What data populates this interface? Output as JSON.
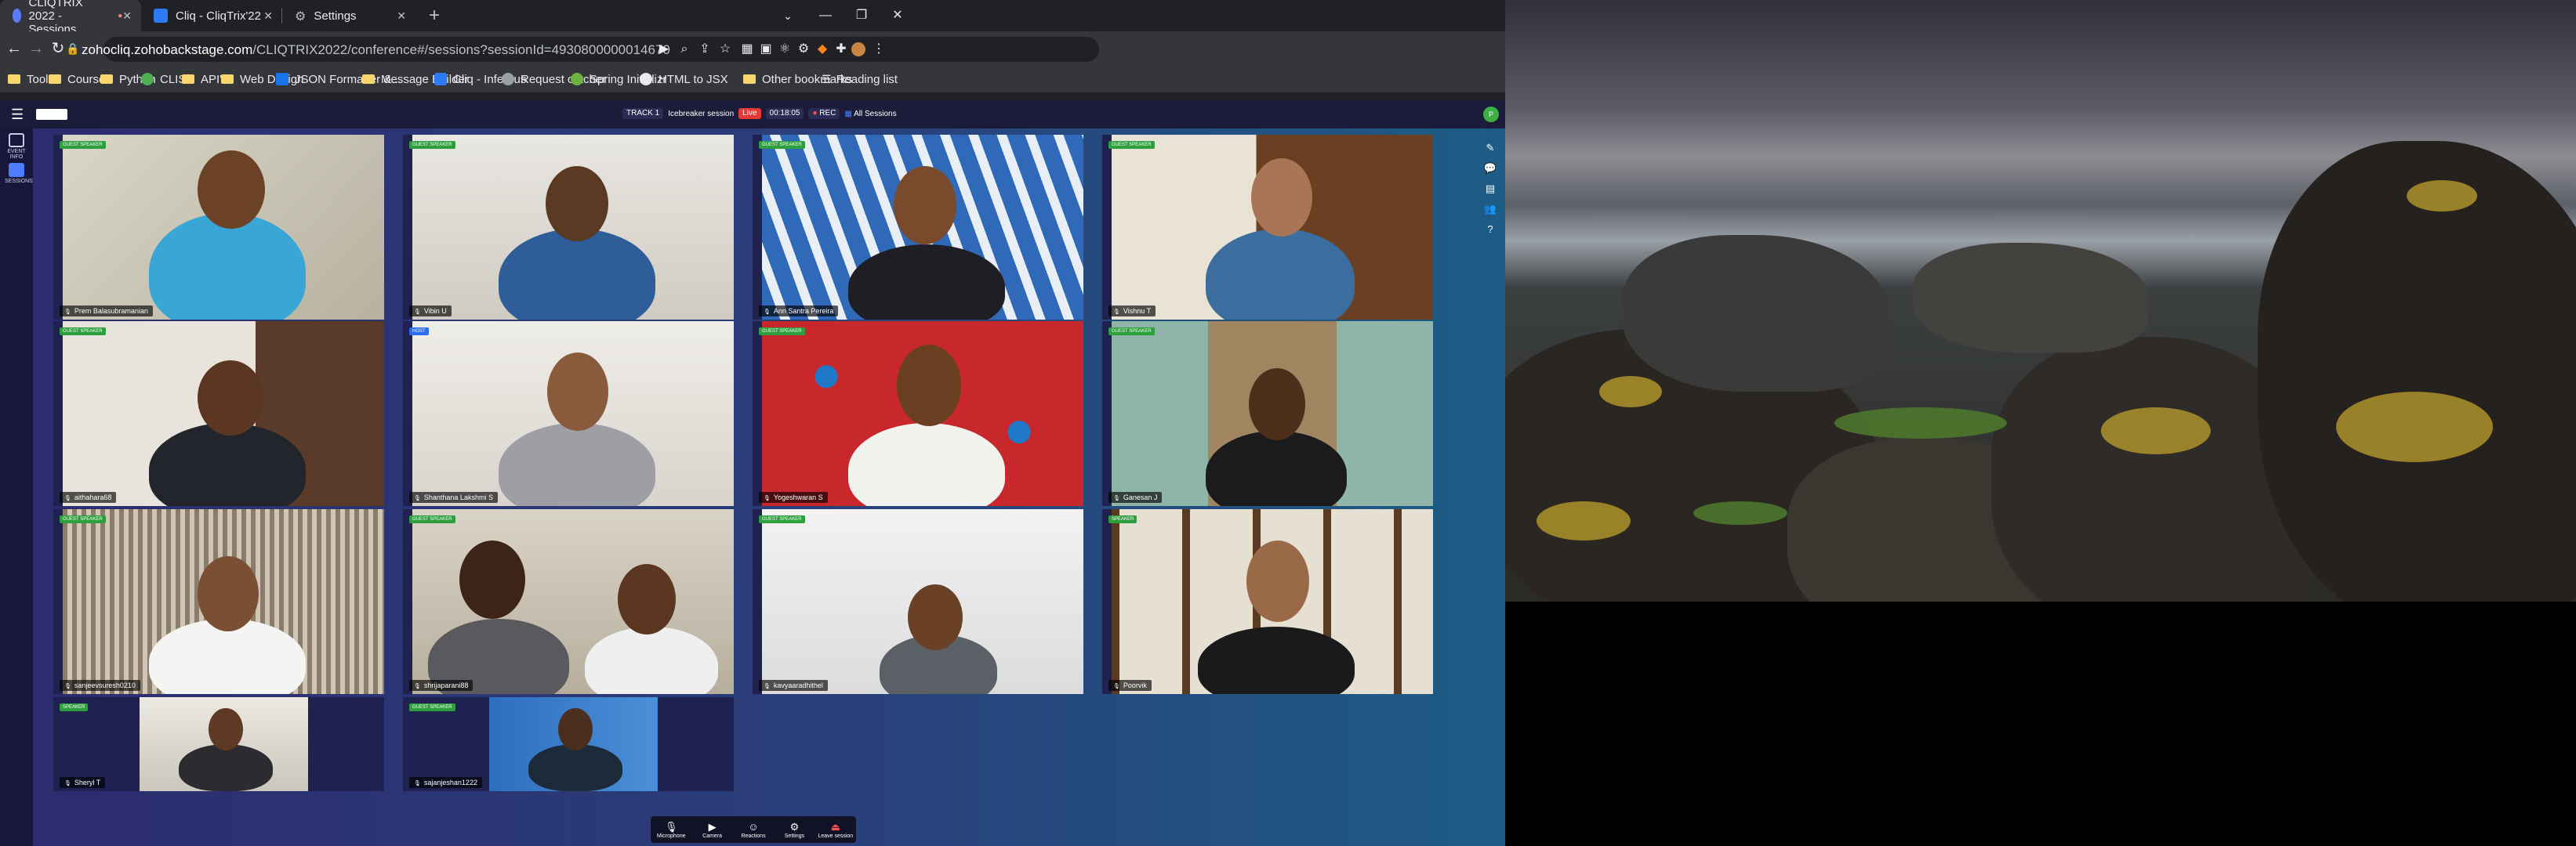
{
  "browser": {
    "tabs": [
      {
        "title": "CLIQTRIX 2022 - Sessions",
        "active": true
      },
      {
        "title": "Cliq - CliqTrix'22",
        "active": false
      },
      {
        "title": "Settings",
        "active": false
      }
    ],
    "url_host": "zohocliq.zohobackstage.com",
    "url_path": "/CLIQTRIX2022/conference#/sessions?sessionId=4930800000014670",
    "bookmarks": [
      "Tools",
      "Courses",
      "Python",
      "CLIST",
      "API's",
      "Web Design",
      "JSON Formatter &...",
      "Message Builder",
      "Cliq - Infernus",
      "Request catcher",
      "Spring Initializr",
      "HTML to JSX"
    ],
    "other_bookmarks": "Other bookmarks",
    "reading_list": "Reading list"
  },
  "session": {
    "track": "TRACK 1",
    "name": "Icebreaker session",
    "live": "Live",
    "timer": "00:18:05",
    "rec": "REC",
    "all_sessions": "All Sessions",
    "user_initials": "P"
  },
  "leftnav": [
    {
      "label": "EVENT INFO"
    },
    {
      "label": "SESSIONS"
    }
  ],
  "tiles": [
    {
      "name": "Prem Balasubramanian",
      "badge": "GUEST SPEAKER"
    },
    {
      "name": "Vibin U",
      "badge": "GUEST SPEAKER"
    },
    {
      "name": "Ann Santra Pereira",
      "badge": "GUEST SPEAKER"
    },
    {
      "name": "Vishnu T",
      "badge": "GUEST SPEAKER"
    },
    {
      "name": "aithahara68",
      "badge": "GUEST SPEAKER"
    },
    {
      "name": "Shanthana Lakshmi S",
      "badge": "HOST"
    },
    {
      "name": "Yogeshwaran S",
      "badge": "GUEST SPEAKER"
    },
    {
      "name": "Ganesan J",
      "badge": "GUEST SPEAKER"
    },
    {
      "name": "sanjeevsuresh0210",
      "badge": "GUEST SPEAKER"
    },
    {
      "name": "shrijaparani88",
      "badge": "GUEST SPEAKER"
    },
    {
      "name": "kavyaaradhithel",
      "badge": "GUEST SPEAKER"
    },
    {
      "name": "Poorvik",
      "badge": "SPEAKER"
    },
    {
      "name": "Sheryl T",
      "badge": "SPEAKER"
    },
    {
      "name": "sajanjeshan1222",
      "badge": "GUEST SPEAKER"
    }
  ],
  "controls": [
    "Microphone",
    "Camera",
    "Reactions",
    "Settings",
    "Leave session"
  ]
}
